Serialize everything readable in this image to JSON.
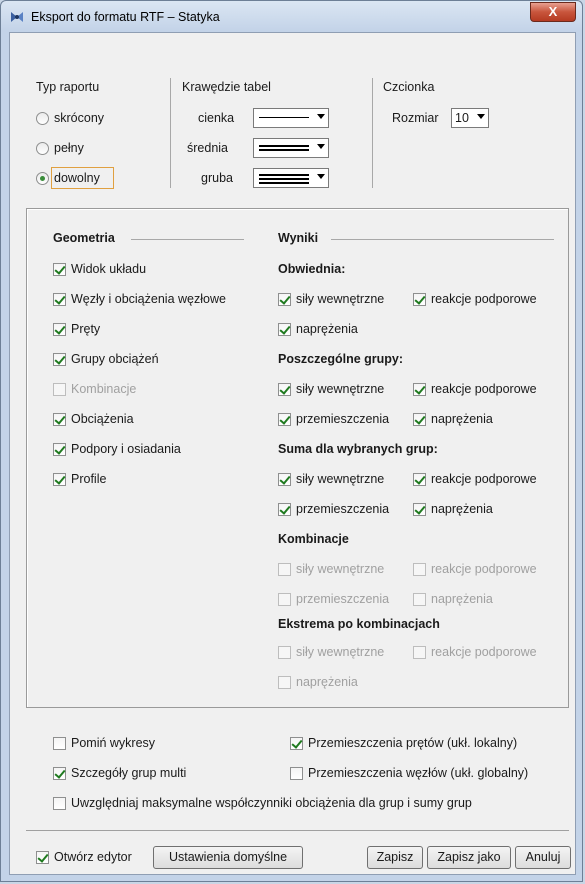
{
  "window": {
    "title": "Eksport do formatu RTF – Statyka",
    "close_label": "X"
  },
  "report_type": {
    "heading": "Typ raportu",
    "options": [
      "skrócony",
      "pełny",
      "dowolny"
    ],
    "selected": "dowolny"
  },
  "table_edges": {
    "heading": "Krawędzie tabel",
    "rows": [
      {
        "label": "cienka"
      },
      {
        "label": "średnia"
      },
      {
        "label": "gruba"
      }
    ]
  },
  "font": {
    "heading": "Czcionka",
    "size_label": "Rozmiar",
    "size_value": "10"
  },
  "geometry": {
    "heading": "Geometria",
    "items": [
      {
        "label": "Widok układu",
        "checked": true,
        "enabled": true
      },
      {
        "label": "Węzły i obciążenia węzłowe",
        "checked": true,
        "enabled": true
      },
      {
        "label": "Pręty",
        "checked": true,
        "enabled": true
      },
      {
        "label": "Grupy obciążeń",
        "checked": true,
        "enabled": true
      },
      {
        "label": "Kombinacje",
        "checked": false,
        "enabled": false
      },
      {
        "label": "Obciążenia",
        "checked": true,
        "enabled": true
      },
      {
        "label": "Podpory i osiadania",
        "checked": true,
        "enabled": true
      },
      {
        "label": "Profile",
        "checked": true,
        "enabled": true
      }
    ]
  },
  "results": {
    "heading": "Wyniki",
    "envelope": {
      "heading": "Obwiednia:",
      "internal_forces": "siły wewnętrzne",
      "reactions": "reakcje podporowe",
      "stresses": "naprężenia"
    },
    "groups": {
      "heading": "Poszczególne grupy:",
      "internal_forces": "siły wewnętrzne",
      "reactions": "reakcje podporowe",
      "displacements": "przemieszczenia",
      "stresses": "naprężenia"
    },
    "sum": {
      "heading": "Suma dla wybranych grup:",
      "internal_forces": "siły wewnętrzne",
      "reactions": "reakcje podporowe",
      "displacements": "przemieszczenia",
      "stresses": "naprężenia"
    },
    "combinations": {
      "heading": "Kombinacje",
      "internal_forces": "siły wewnętrzne",
      "reactions": "reakcje podporowe",
      "displacements": "przemieszczenia",
      "stresses": "naprężenia"
    },
    "extrema": {
      "heading": "Ekstrema po kombinacjach",
      "internal_forces": "siły wewnętrzne",
      "reactions": "reakcje podporowe",
      "stresses": "naprężenia"
    }
  },
  "options": {
    "skip_charts": "Pomiń wykresy",
    "multi_group_details": "Szczegóły grup multi",
    "bar_displacements": "Przemieszczenia prętów (ukł. lokalny)",
    "node_displacements": "Przemieszczenia węzłów (ukł. globalny)",
    "max_load_factors": "Uwzględniaj maksymalne współczynniki obciążenia dla grup i sumy grup"
  },
  "footer": {
    "open_editor": "Otwórz edytor",
    "defaults": "Ustawienia domyślne",
    "save": "Zapisz",
    "save_as": "Zapisz jako",
    "cancel": "Anuluj"
  }
}
